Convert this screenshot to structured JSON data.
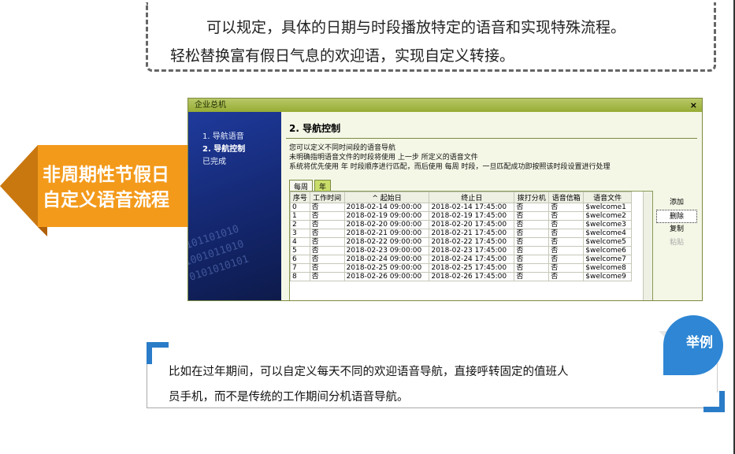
{
  "intro": {
    "line1": "可以规定，具体的日期与时段播放特定的语音和实现特殊流程。",
    "line2": "轻松替换富有假日气息的欢迎语，实现自定义转接。"
  },
  "banner": {
    "line1": "非周期性节假日",
    "line2": "自定义语音流程"
  },
  "window": {
    "title": "企业总机",
    "close": "×",
    "steps": [
      "1. 导航语音",
      "2. 导航控制",
      "已完成"
    ],
    "heading": "2. 导航控制",
    "desc1": "您可以定义不同时间段的语音导航",
    "desc2": "未明确指明语音文件的时段将使用 上一步 所定义的语音文件",
    "desc3": "系统将优先使用 年 时段顺序进行匹配，而后使用 每周 时段，一旦匹配成功即按照该时段设置进行处理",
    "tabs": [
      "每周",
      "年"
    ],
    "columns": [
      "序号",
      "工作时间",
      "^ 起始日",
      "终止日",
      "拨打分机",
      "语音信箱",
      "语音文件"
    ],
    "rows": [
      [
        "0",
        "否",
        "2018-02-14 09:00:00",
        "2018-02-14 17:45:00",
        "否",
        "否",
        "$welcome1"
      ],
      [
        "1",
        "否",
        "2018-02-19 09:00:00",
        "2018-02-19 17:45:00",
        "否",
        "否",
        "$welcome2"
      ],
      [
        "2",
        "否",
        "2018-02-20 09:00:00",
        "2018-02-20 17:45:00",
        "否",
        "否",
        "$welcome3"
      ],
      [
        "3",
        "否",
        "2018-02-21 09:00:00",
        "2018-02-21 17:45:00",
        "否",
        "否",
        "$welcome4"
      ],
      [
        "4",
        "否",
        "2018-02-22 09:00:00",
        "2018-02-22 17:45:00",
        "否",
        "否",
        "$welcome5"
      ],
      [
        "5",
        "否",
        "2018-02-23 09:00:00",
        "2018-02-23 17:45:00",
        "否",
        "否",
        "$welcome6"
      ],
      [
        "6",
        "否",
        "2018-02-24 09:00:00",
        "2018-02-24 17:45:00",
        "否",
        "否",
        "$welcome7"
      ],
      [
        "7",
        "否",
        "2018-02-25 09:00:00",
        "2018-02-25 17:45:00",
        "否",
        "否",
        "$welcome8"
      ],
      [
        "8",
        "否",
        "2018-02-26 09:00:00",
        "2018-02-26 17:45:00",
        "否",
        "否",
        "$welcome9"
      ]
    ],
    "actions": {
      "add": "添加",
      "delete": "删除",
      "copy": "复制",
      "paste": "粘贴"
    },
    "sidebar_deco": "0101101010\n1001011010\n0101010101"
  },
  "example": {
    "badge": "举例",
    "line1": "比如在过年期间，可以自定义每天不同的欢迎语音导航，直接呼转固定的值班人",
    "line2": "员手机，而不是传统的工作期间分机语音导航。"
  }
}
